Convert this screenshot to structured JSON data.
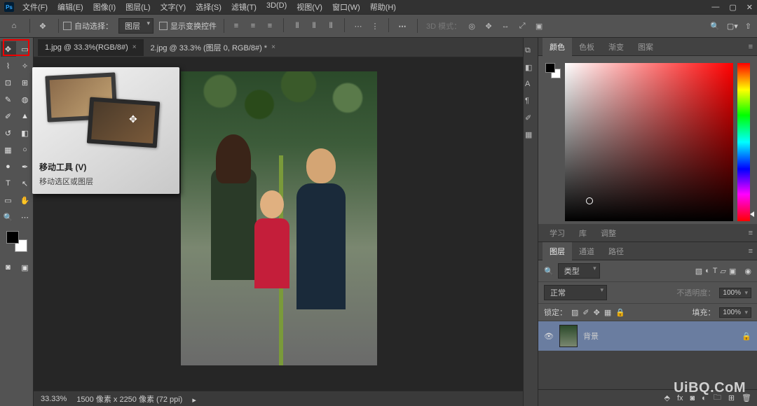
{
  "menubar": {
    "items": [
      "文件(F)",
      "编辑(E)",
      "图像(I)",
      "图层(L)",
      "文字(Y)",
      "选择(S)",
      "滤镜(T)",
      "3D(D)",
      "视图(V)",
      "窗口(W)",
      "帮助(H)"
    ]
  },
  "optionsbar": {
    "auto_select_label": "自动选择：",
    "auto_select_value": "图层",
    "show_transform_label": "显示变换控件",
    "mode3d_label": "3D 模式："
  },
  "tabs": [
    {
      "label": "1.jpg @ 33.3%(RGB/8#)",
      "active": true
    },
    {
      "label": "2.jpg @ 33.3% (图层 0, RGB/8#) *",
      "active": false
    }
  ],
  "tooltip": {
    "title": "移动工具 (V)",
    "desc": "移动选区或图层"
  },
  "statusbar": {
    "zoom": "33.33%",
    "dims": "1500 像素 x 2250 像素 (72 ppi)"
  },
  "color_tabs": [
    "颜色",
    "色板",
    "渐变",
    "图案"
  ],
  "learn_tabs": [
    "学习",
    "库",
    "调整"
  ],
  "layer_tabs": [
    "图层",
    "通道",
    "路径"
  ],
  "layers": {
    "kind_label": "类型",
    "blend_mode": "正常",
    "opacity_label": "不透明度：",
    "opacity_value": "100%",
    "lock_label": "锁定：",
    "fill_label": "填充：",
    "fill_value": "100%",
    "items": [
      {
        "name": "背景",
        "locked": true
      }
    ]
  },
  "watermark": "UiBQ.CoM"
}
